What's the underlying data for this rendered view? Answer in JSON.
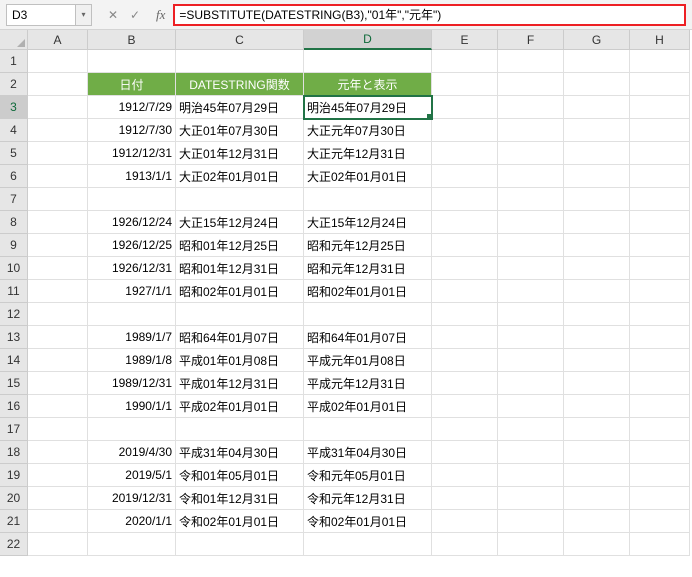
{
  "nameBox": "D3",
  "formula": "=SUBSTITUTE(DATESTRING(B3),\"01年\",\"元年\")",
  "fxLabel": "fx",
  "colLabels": {
    "A": "A",
    "B": "B",
    "C": "C",
    "D": "D",
    "E": "E",
    "F": "F",
    "G": "G",
    "H": "H"
  },
  "rowLabels": [
    "1",
    "2",
    "3",
    "4",
    "5",
    "6",
    "7",
    "8",
    "9",
    "10",
    "11",
    "12",
    "13",
    "14",
    "15",
    "16",
    "17",
    "18",
    "19",
    "20",
    "21",
    "22"
  ],
  "headers": {
    "b": "日付",
    "c": "DATESTRING関数",
    "d": "元年と表示"
  },
  "rows": {
    "3": {
      "b": "1912/7/29",
      "c": "明治45年07月29日",
      "d": "明治45年07月29日"
    },
    "4": {
      "b": "1912/7/30",
      "c": "大正01年07月30日",
      "d": "大正元年07月30日"
    },
    "5": {
      "b": "1912/12/31",
      "c": "大正01年12月31日",
      "d": "大正元年12月31日"
    },
    "6": {
      "b": "1913/1/1",
      "c": "大正02年01月01日",
      "d": "大正02年01月01日"
    },
    "8": {
      "b": "1926/12/24",
      "c": "大正15年12月24日",
      "d": "大正15年12月24日"
    },
    "9": {
      "b": "1926/12/25",
      "c": "昭和01年12月25日",
      "d": "昭和元年12月25日"
    },
    "10": {
      "b": "1926/12/31",
      "c": "昭和01年12月31日",
      "d": "昭和元年12月31日"
    },
    "11": {
      "b": "1927/1/1",
      "c": "昭和02年01月01日",
      "d": "昭和02年01月01日"
    },
    "13": {
      "b": "1989/1/7",
      "c": "昭和64年01月07日",
      "d": "昭和64年01月07日"
    },
    "14": {
      "b": "1989/1/8",
      "c": "平成01年01月08日",
      "d": "平成元年01月08日"
    },
    "15": {
      "b": "1989/12/31",
      "c": "平成01年12月31日",
      "d": "平成元年12月31日"
    },
    "16": {
      "b": "1990/1/1",
      "c": "平成02年01月01日",
      "d": "平成02年01月01日"
    },
    "18": {
      "b": "2019/4/30",
      "c": "平成31年04月30日",
      "d": "平成31年04月30日"
    },
    "19": {
      "b": "2019/5/1",
      "c": "令和01年05月01日",
      "d": "令和元年05月01日"
    },
    "20": {
      "b": "2019/12/31",
      "c": "令和01年12月31日",
      "d": "令和元年12月31日"
    },
    "21": {
      "b": "2020/1/1",
      "c": "令和02年01月01日",
      "d": "令和02年01月01日"
    }
  },
  "icons": {
    "x": "✕",
    "check": "✓",
    "dd": "▾"
  }
}
